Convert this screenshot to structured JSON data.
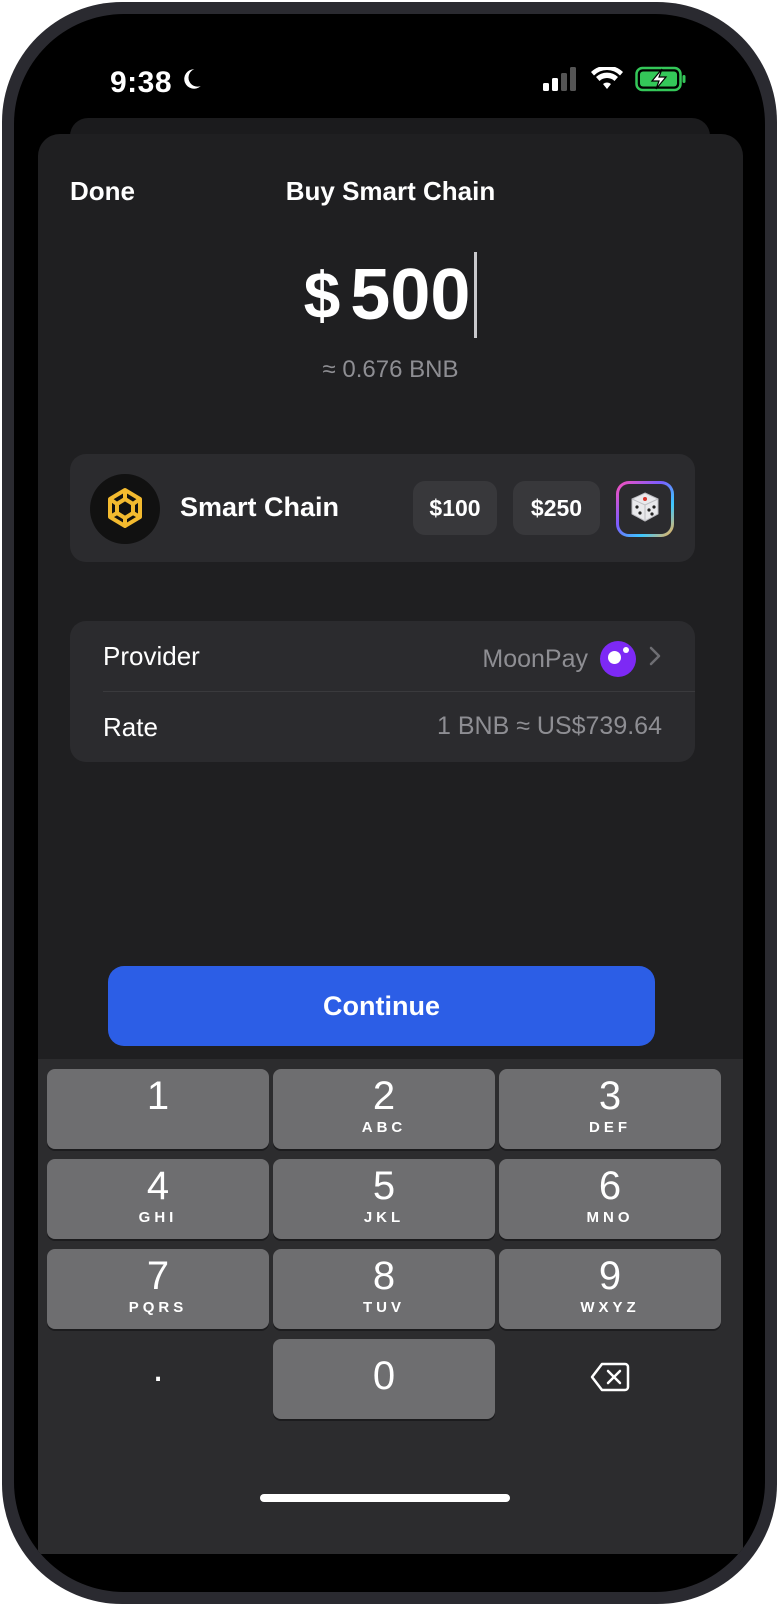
{
  "status": {
    "time": "9:38"
  },
  "header": {
    "done_label": "Done",
    "title": "Buy Smart Chain"
  },
  "amount": {
    "currency_symbol": "$",
    "value": "500",
    "approx": "≈ 0.676 BNB"
  },
  "asset": {
    "name": "Smart Chain",
    "presets": [
      "$100",
      "$250"
    ]
  },
  "info": {
    "provider_label": "Provider",
    "provider_value": "MoonPay",
    "rate_label": "Rate",
    "rate_value": "1 BNB ≈ US$739.64"
  },
  "continue_label": "Continue",
  "keypad": {
    "keys": [
      {
        "num": "1",
        "sub": ""
      },
      {
        "num": "2",
        "sub": "ABC"
      },
      {
        "num": "3",
        "sub": "DEF"
      },
      {
        "num": "4",
        "sub": "GHI"
      },
      {
        "num": "5",
        "sub": "JKL"
      },
      {
        "num": "6",
        "sub": "MNO"
      },
      {
        "num": "7",
        "sub": "PQRS"
      },
      {
        "num": "8",
        "sub": "TUV"
      },
      {
        "num": "9",
        "sub": "WXYZ"
      },
      {
        "num": ".",
        "sub": ""
      },
      {
        "num": "0",
        "sub": ""
      }
    ]
  },
  "colors": {
    "accent": "#2c5ee6",
    "provider_brand": "#7d29f5",
    "asset_brand": "#f3ba2f",
    "battery": "#34c759"
  }
}
